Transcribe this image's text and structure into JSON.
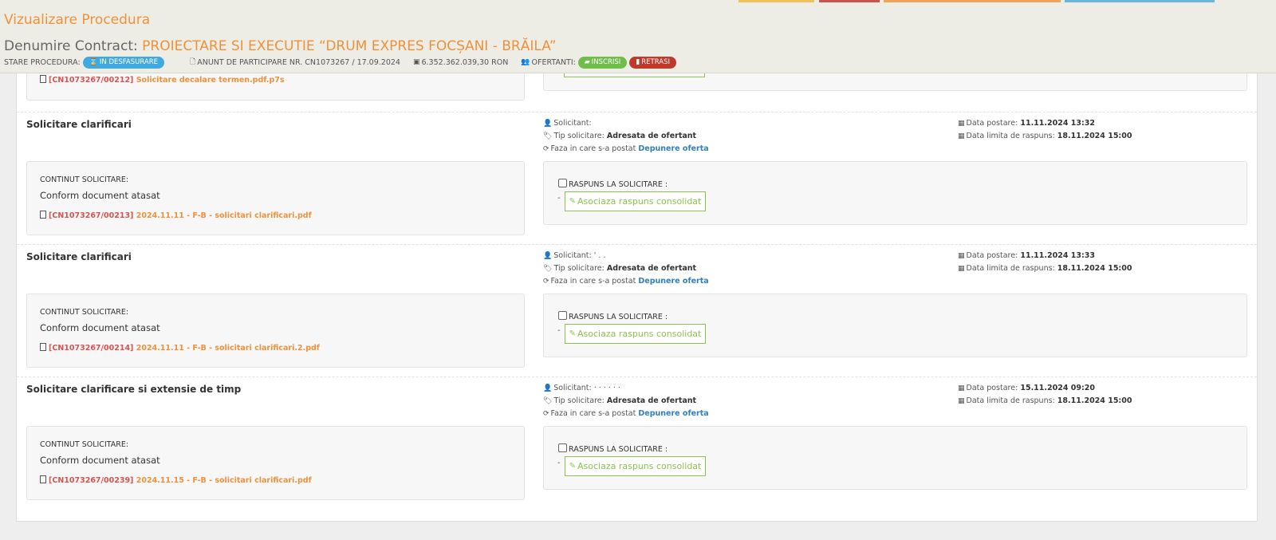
{
  "header": {
    "title": "Vizualizare Procedura",
    "contract_label": "Denumire Contract:",
    "contract_name": "PROIECTARE SI EXECUTIE “DRUM EXPRES FOCȘANI - BRĂILA”",
    "status_label": "STARE PROCEDURA:",
    "status_badge": "IN DESFASURARE",
    "announcement": "ANUNT DE PARTICIPARE NR. CN1073267 / 17.09.2024",
    "value": "6.352.362.039,30  RON",
    "bidders_label": "OFERTANTI:",
    "badge_enrolled": "INSCRISI",
    "badge_withdrawn": "RETRASI",
    "strip_colors": [
      "#f0c05a",
      "#c9544e",
      "#f0a35a",
      "#6cb4e0"
    ]
  },
  "partial": {
    "file_id": "[CN1073267/00212]",
    "file_name": "Solicitare decalare termen.pdf.p7s"
  },
  "labels": {
    "solicitant": "Solicitant:",
    "tip": "Tip solicitare:",
    "faza": "Faza in care s-a postat",
    "data_postare": "Data postare:",
    "data_limita": "Data limita de raspuns:",
    "continut": "CONTINUT SOLICITARE:",
    "raspuns": "RASPUNS LA SOLICITARE :",
    "assoc_button": "Asociaza raspuns consolidat",
    "dash": "-"
  },
  "requests": [
    {
      "title": "Solicitare clarificari",
      "solicitant": "",
      "tip": "Adresata de ofertant",
      "faza": "Depunere oferta",
      "data_postare": "11.11.2024 13:32",
      "data_limita": "18.11.2024 15:00",
      "continut": "Conform document atasat",
      "file_id": "[CN1073267/00213]",
      "file_name": "2024.11.11 - F-B - solicitari clarificari.pdf"
    },
    {
      "title": "Solicitare clarificari",
      "solicitant": "' . .",
      "tip": "Adresata de ofertant",
      "faza": "Depunere oferta",
      "data_postare": "11.11.2024 13:33",
      "data_limita": "18.11.2024 15:00",
      "continut": "Conform document atasat",
      "file_id": "[CN1073267/00214]",
      "file_name": "2024.11.11 - F-B - solicitari clarificari.2.pdf"
    },
    {
      "title": "Solicitare clarificare si extensie de timp",
      "solicitant": "· · · · · ·",
      "tip": "Adresata de ofertant",
      "faza": "Depunere oferta",
      "data_postare": "15.11.2024 09:20",
      "data_limita": "18.11.2024 15:00",
      "continut": "Conform document atasat",
      "file_id": "[CN1073267/00239]",
      "file_name": "2024.11.15 - F-B - solicitari clarificari.pdf"
    }
  ]
}
